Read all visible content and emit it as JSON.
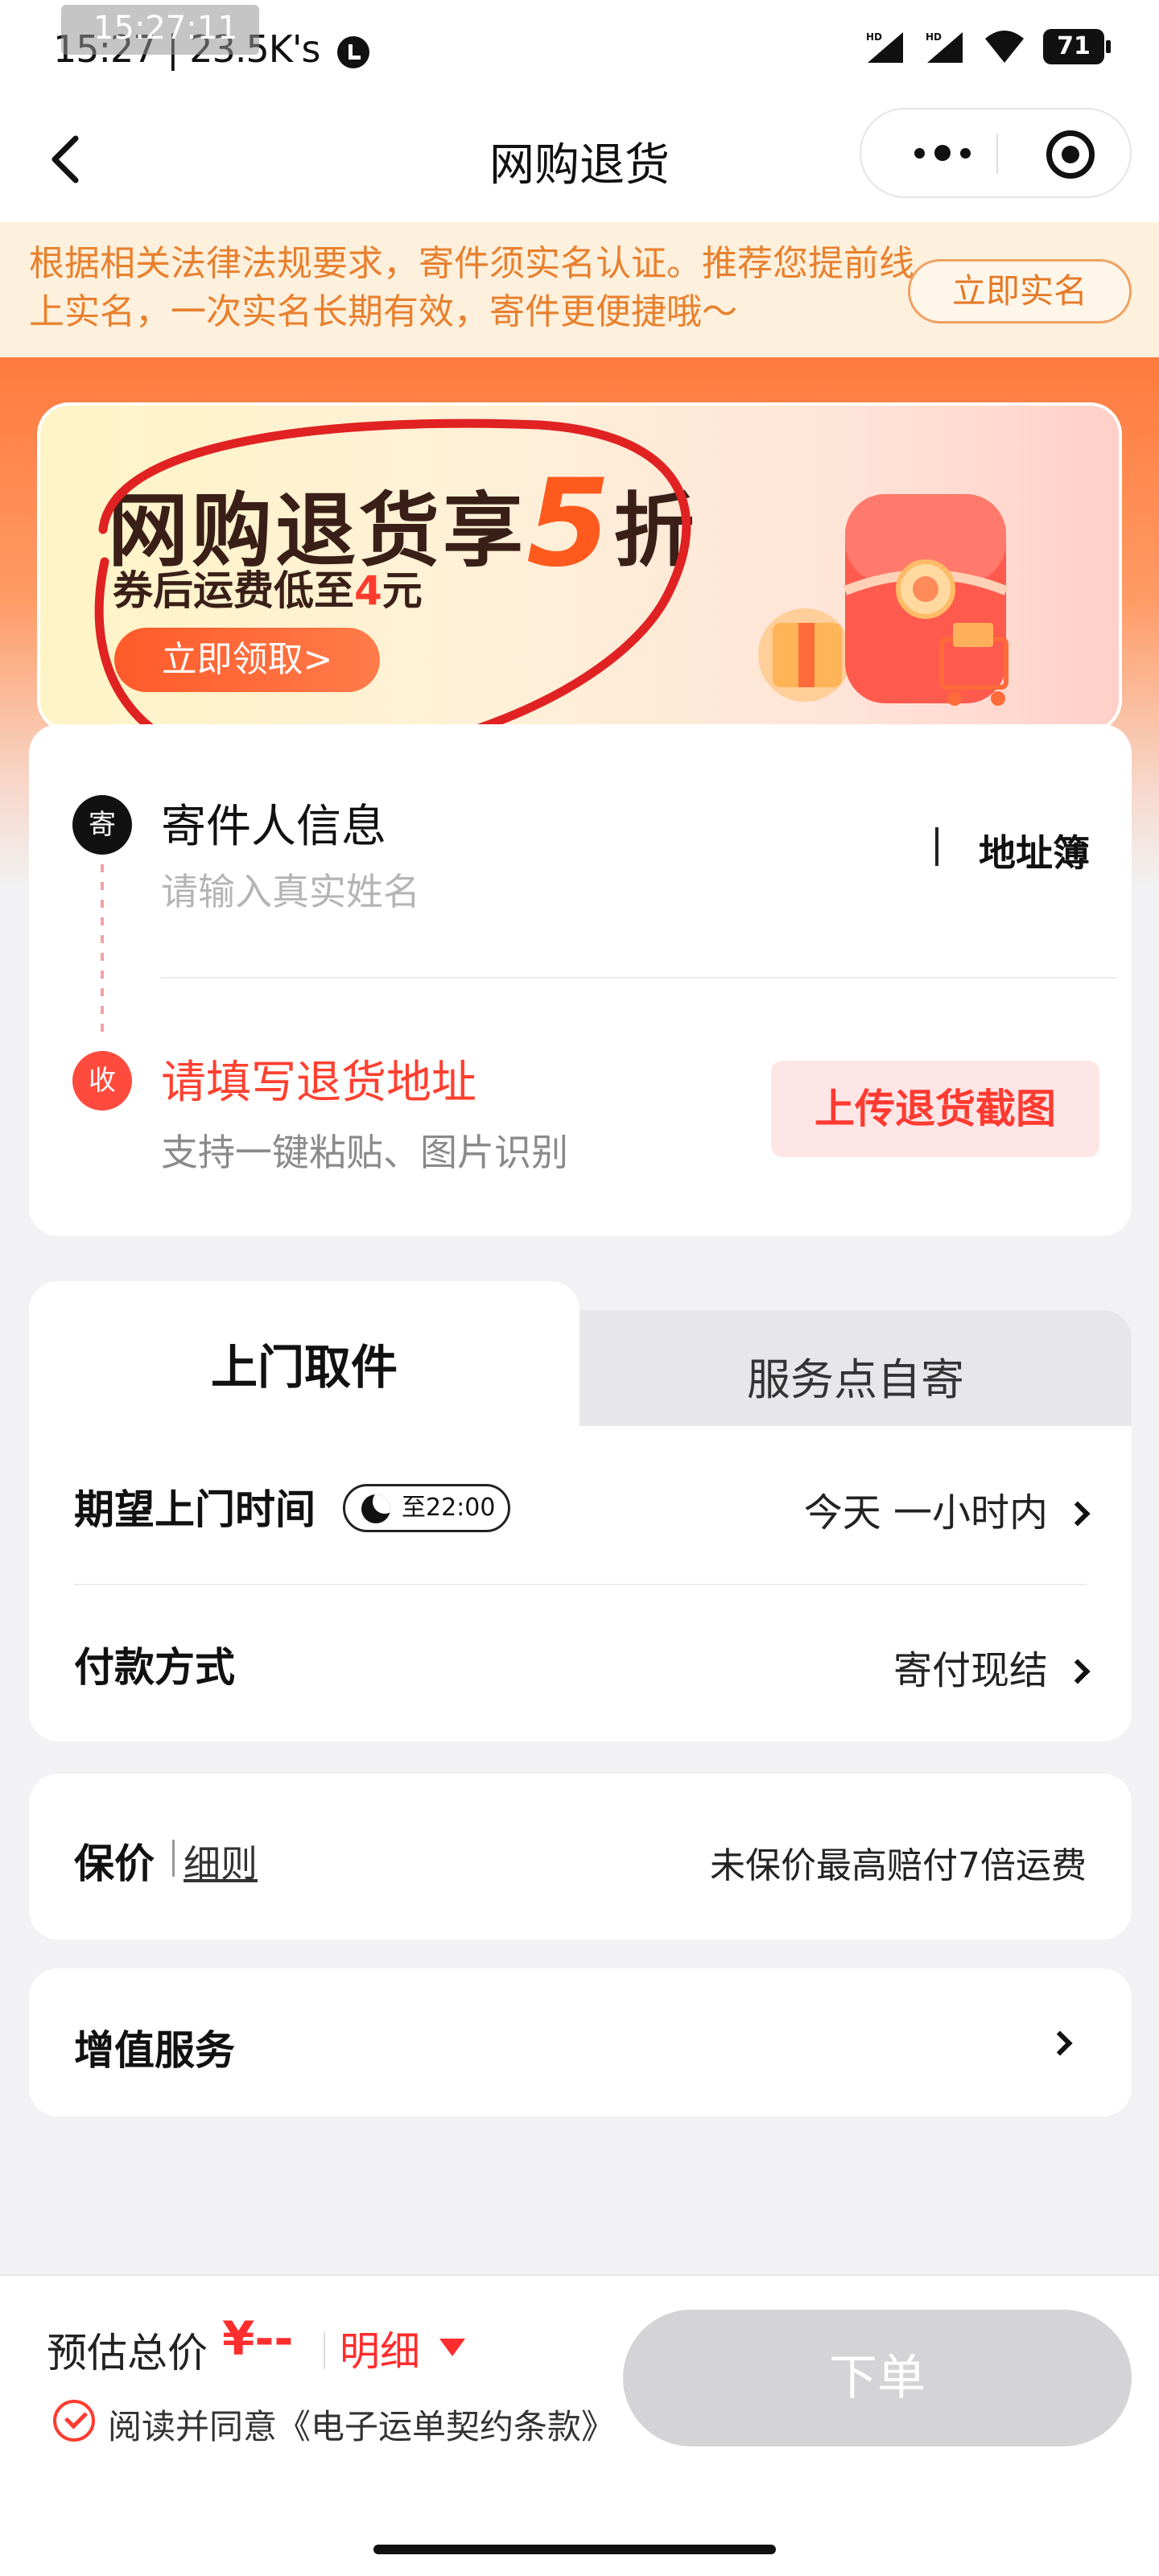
{
  "status_bar": {
    "time": "15:27 | 23.5K's",
    "overlay_time": "15:27:11",
    "battery": "71",
    "signal_label": "HD"
  },
  "navbar": {
    "title": "网购退货",
    "back_icon": "chevron-left-icon",
    "more_icon": "more-dots-icon",
    "close_icon": "target-close-icon"
  },
  "notice": {
    "text": "根据相关法律法规要求，寄件须实名认证。推荐您提前线上实名，一次实名长期有效，寄件更便捷哦～",
    "button": "立即实名"
  },
  "promo": {
    "title_prefix": "网购退货享",
    "title_number": "5",
    "title_suffix": "折",
    "sub_prefix": "券后运费低至",
    "sub_amount": "4",
    "sub_suffix": "元",
    "button": "立即领取>"
  },
  "address": {
    "sender_tag": "寄",
    "sender_title": "寄件人信息",
    "sender_hint": "请输入真实姓名",
    "address_book": "地址簿",
    "receiver_tag": "收",
    "receiver_title": "请填写退货地址",
    "receiver_hint": "支持一键粘贴、图片识别",
    "upload_button": "上传退货截图"
  },
  "service": {
    "tabs": [
      {
        "label": "上门取件",
        "active": true
      },
      {
        "label": "服务点自寄",
        "active": false
      }
    ],
    "pickup_time_label": "期望上门时间",
    "pickup_badge": "至22:00",
    "pickup_time_value": "今天 一小时内",
    "payment_label": "付款方式",
    "payment_value": "寄付现结"
  },
  "insurance": {
    "label": "保价",
    "link": "细则",
    "value": "未保价最高赔付7倍运费"
  },
  "value_added": {
    "label": "增值服务"
  },
  "bottom": {
    "estimate_label": "预估总价",
    "estimate_price": "¥--",
    "detail_link": "明细",
    "agree_text": "阅读并同意《电子运单契约条款》",
    "order_button": "下单"
  },
  "colors": {
    "accent_red": "#ff3b30",
    "orange": "#ff7a3e",
    "notice_text": "#e8802e"
  }
}
